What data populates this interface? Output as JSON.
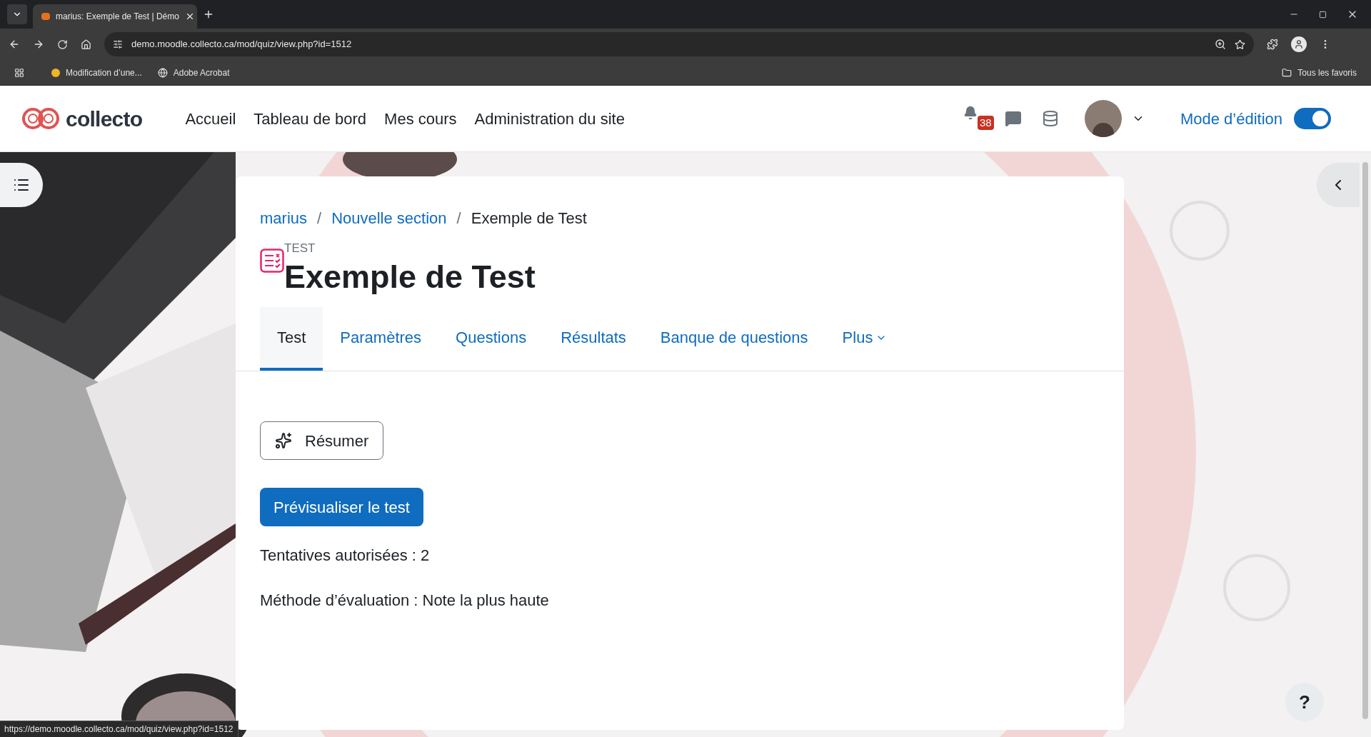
{
  "browser": {
    "tab_title": "marius: Exemple de Test | Démo",
    "url": "demo.moodle.collecto.ca/mod/quiz/view.php?id=1512",
    "bookmarks": [
      "Modification d’une...",
      "Adobe Acrobat"
    ],
    "all_bookmarks": "Tous les favoris"
  },
  "header": {
    "logo": "collecto",
    "nav": [
      "Accueil",
      "Tableau de bord",
      "Mes cours",
      "Administration du site"
    ],
    "notification_count": "38",
    "edit_mode": {
      "label": "Mode d’édition",
      "on": true
    }
  },
  "breadcrumb": {
    "separator": "/",
    "items": [
      {
        "label": "marius",
        "link": true
      },
      {
        "label": "Nouvelle section",
        "link": true
      },
      {
        "label": "Exemple de Test",
        "link": false
      }
    ]
  },
  "activity": {
    "type_label": "TEST",
    "title": "Exemple de Test"
  },
  "tabs": [
    {
      "label": "Test",
      "selected": true,
      "kind": "tab"
    },
    {
      "label": "Paramètres",
      "selected": false,
      "kind": "tab"
    },
    {
      "label": "Questions",
      "selected": false,
      "kind": "tab"
    },
    {
      "label": "Résultats",
      "selected": false,
      "kind": "tab"
    },
    {
      "label": "Banque de questions",
      "selected": false,
      "kind": "tab"
    },
    {
      "label": "Plus",
      "selected": false,
      "kind": "menu"
    }
  ],
  "actions": {
    "summarize": "Résumer",
    "preview": "Prévisualiser le test"
  },
  "info": [
    "Tentatives autorisées : 2",
    "Méthode d’évaluation : Note la plus haute"
  ],
  "help": "?",
  "status_bar": "https://demo.moodle.collecto.ca/mod/quiz/view.php?id=1512"
}
